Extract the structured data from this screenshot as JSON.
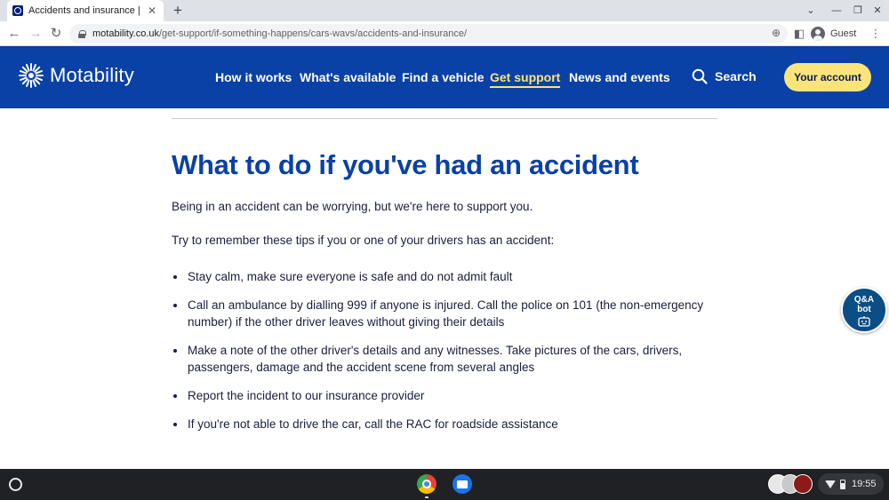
{
  "browser": {
    "tab_title": "Accidents and insurance | Motab",
    "tab_close": "✕",
    "new_tab": "+",
    "url_host": "motability.co.uk",
    "url_path": "/get-support/if-something-happens/cars-wavs/accidents-and-insurance/",
    "profile_label": "Guest"
  },
  "site": {
    "brand": "Motability",
    "nav": [
      {
        "label": "How it works",
        "active": false
      },
      {
        "label": "What's available",
        "active": false
      },
      {
        "label": "Find a vehicle",
        "active": false
      },
      {
        "label": "Get support",
        "active": true
      },
      {
        "label": "News and events",
        "active": false
      }
    ],
    "search_label": "Search",
    "account_button": "Your account",
    "colors": {
      "header": "#0a41a6",
      "accent": "#fde47a",
      "title": "#0a41a6"
    }
  },
  "content": {
    "title": "What to do if you've had an accident",
    "intro": "Being in an accident can be worrying, but we're here to support you.",
    "tips_lead": "Try to remember these tips if you or one of your drivers has an accident:",
    "tips": [
      "Stay calm, make sure everyone is safe and do not admit fault",
      "Call an ambulance by dialling 999 if anyone is injured. Call the police on 101 (the non-emergency number) if the other driver leaves without giving their details",
      "Make a note of the other driver's details and any witnesses. Take pictures of the cars, drivers, passengers, damage and the accident scene from several angles",
      "Report the incident to our insurance provider",
      "If you're not able to drive the car, call the RAC for roadside assistance"
    ]
  },
  "qa_bot": {
    "line1": "Q&A",
    "line2": "bot"
  },
  "shelf": {
    "time": "19:55"
  }
}
